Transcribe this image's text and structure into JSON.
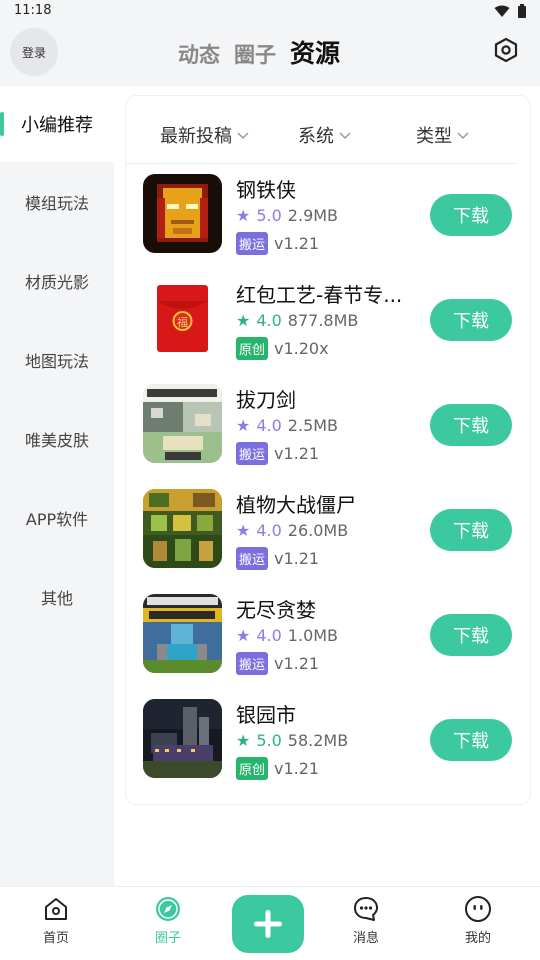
{
  "status_bar": {
    "time": "11:18"
  },
  "header": {
    "login_label": "登录",
    "tabs": [
      {
        "label": "动态",
        "active": false
      },
      {
        "label": "圈子",
        "active": false
      },
      {
        "label": "资源",
        "active": true
      }
    ],
    "settings_icon": "settings-hex-icon"
  },
  "sidebar": {
    "items": [
      {
        "label": "小编推荐",
        "active": true
      },
      {
        "label": "模组玩法",
        "active": false
      },
      {
        "label": "材质光影",
        "active": false
      },
      {
        "label": "地图玩法",
        "active": false
      },
      {
        "label": "唯美皮肤",
        "active": false
      },
      {
        "label": "APP软件",
        "active": false
      },
      {
        "label": "其他",
        "active": false
      }
    ]
  },
  "filters": [
    {
      "label": "最新投稿"
    },
    {
      "label": "系统"
    },
    {
      "label": "类型"
    }
  ],
  "apps": [
    {
      "name": "钢铁侠",
      "rating": "5.0",
      "rating_color": "#8a7fe0",
      "size": "2.9MB",
      "tag": "搬运",
      "tag_color": "#7b6fe0",
      "version": "v1.21",
      "button": "下载",
      "icon": "iron-man-icon"
    },
    {
      "name": "红包工艺-春节专...",
      "rating": "4.0",
      "rating_color": "#2fb37d",
      "size": "877.8MB",
      "tag": "原创",
      "tag_color": "#27b46d",
      "version": "v1.20x",
      "button": "下载",
      "icon": "red-envelope-icon"
    },
    {
      "name": "拔刀剑",
      "rating": "4.0",
      "rating_color": "#8a7fe0",
      "size": "2.5MB",
      "tag": "搬运",
      "tag_color": "#7b6fe0",
      "version": "v1.21",
      "button": "下载",
      "icon": "sword-mod-icon"
    },
    {
      "name": "植物大战僵尸",
      "rating": "4.0",
      "rating_color": "#8a7fe0",
      "size": "26.0MB",
      "tag": "搬运",
      "tag_color": "#7b6fe0",
      "version": "v1.21",
      "button": "下载",
      "icon": "plants-zombies-icon"
    },
    {
      "name": "无尽贪婪",
      "rating": "4.0",
      "rating_color": "#8a7fe0",
      "size": "1.0MB",
      "tag": "搬运",
      "tag_color": "#7b6fe0",
      "version": "v1.21",
      "button": "下载",
      "icon": "minecraft-addon-icon"
    },
    {
      "name": "银园市",
      "rating": "5.0",
      "rating_color": "#2fb37d",
      "size": "58.2MB",
      "tag": "原创",
      "tag_color": "#27b46d",
      "version": "v1.21",
      "button": "下载",
      "icon": "night-city-icon"
    }
  ],
  "bottom_nav": [
    {
      "label": "首页",
      "icon": "home-icon",
      "active": false
    },
    {
      "label": "圈子",
      "icon": "compass-icon",
      "active": true
    },
    {
      "label": "",
      "icon": "plus-icon",
      "active": false
    },
    {
      "label": "消息",
      "icon": "message-icon",
      "active": false
    },
    {
      "label": "我的",
      "icon": "profile-icon",
      "active": false
    }
  ],
  "accent_color": "#3cc9a0"
}
